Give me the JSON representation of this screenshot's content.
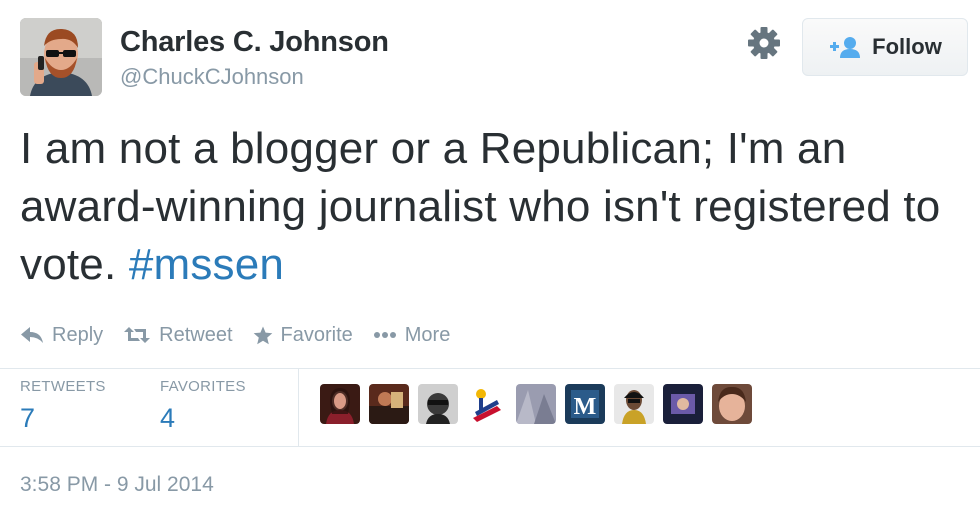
{
  "user": {
    "name": "Charles C. Johnson",
    "handle": "@ChuckCJohnson"
  },
  "follow_button": {
    "label": "Follow"
  },
  "tweet": {
    "text_before": "I am not a blogger or a Republican; I'm an award-winning journalist who isn't registered to vote. ",
    "hashtag": "#mssen"
  },
  "actions": {
    "reply": "Reply",
    "retweet": "Retweet",
    "favorite": "Favorite",
    "more": "More"
  },
  "stats": {
    "retweets_label": "RETWEETS",
    "retweets_count": "7",
    "favorites_label": "FAVORITES",
    "favorites_count": "4"
  },
  "timestamp": "3:58 PM - 9 Jul 2014",
  "colors": {
    "link_blue": "#2b7bb9",
    "muted_gray": "#8899a6",
    "text_dark": "#292f33"
  }
}
